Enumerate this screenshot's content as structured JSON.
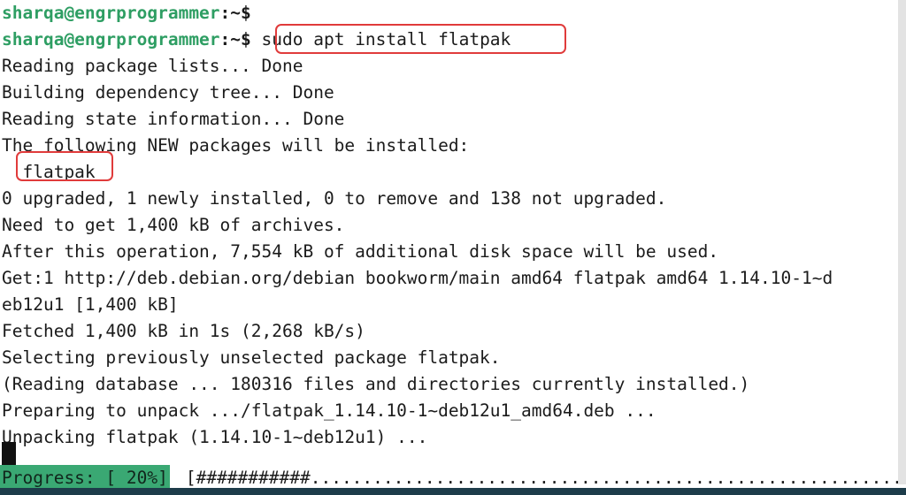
{
  "terminal": {
    "user_host": "sharqa@engrprogrammer",
    "path_sign": ":~$",
    "command": "sudo apt install flatpak",
    "lines": [
      "Reading package lists... Done",
      "Building dependency tree... Done",
      "Reading state information... Done",
      "The following NEW packages will be installed:",
      "  flatpak",
      "0 upgraded, 1 newly installed, 0 to remove and 138 not upgraded.",
      "Need to get 1,400 kB of archives.",
      "After this operation, 7,554 kB of additional disk space will be used.",
      "Get:1 http://deb.debian.org/debian bookworm/main amd64 flatpak amd64 1.14.10-1~d",
      "eb12u1 [1,400 kB]",
      "Fetched 1,400 kB in 1s (2,268 kB/s)",
      "Selecting previously unselected package flatpak.",
      "(Reading database ... 180316 files and directories currently installed.)",
      "Preparing to unpack .../flatpak_1.14.10-1~deb12u1_amd64.deb ...",
      "Unpacking flatpak (1.14.10-1~deb12u1) ..."
    ]
  },
  "progress": {
    "label": "Progress: [ 20%]",
    "percent": "20%",
    "bar": "[###########..........................................................]",
    "filled_marks": 11,
    "total_marks": 69
  },
  "annotations": {
    "highlight_command": "sudo apt install flatpak",
    "highlight_package": "flatpak",
    "highlight_color": "#e03b3b"
  },
  "colors": {
    "background": "#ffffff",
    "text": "#1b1b1b",
    "prompt_green": "#2e9e63",
    "progress_green": "#3aa873",
    "bottom_strip": "#1d3c4a"
  }
}
